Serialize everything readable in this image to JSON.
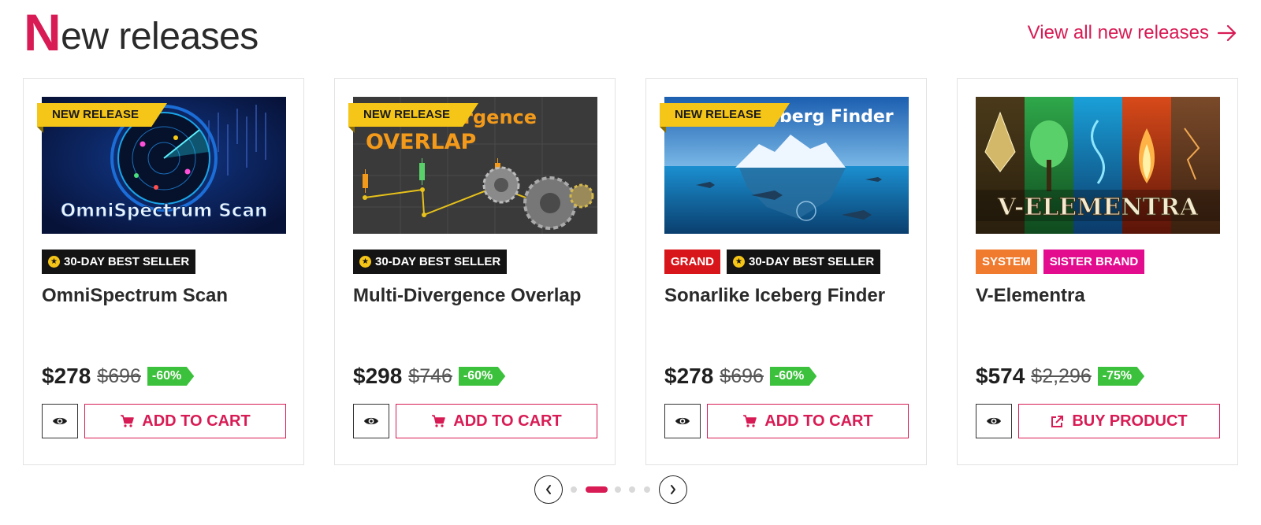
{
  "header": {
    "title_first": "N",
    "title_rest": "ew releases",
    "view_all": "View all new releases"
  },
  "colors": {
    "accent": "#d81b54",
    "ribbon": "#f5c518",
    "discount": "#3cc13c",
    "grand": "#d8151a",
    "system": "#f07a2d",
    "sister": "#e30c8f"
  },
  "products": [
    {
      "ribbon": "NEW RELEASE",
      "image_title": "OmniSpectrum Scan",
      "badges": [
        "30-DAY BEST SELLER"
      ],
      "name": "OmniSpectrum Scan",
      "price": "$278",
      "old_price": "$696",
      "discount": "-60%",
      "button": "ADD TO CART",
      "button_icon": "cart-icon"
    },
    {
      "ribbon": "NEW RELEASE",
      "image_title": "Multi-Divergence Overlap",
      "badges": [
        "30-DAY BEST SELLER"
      ],
      "name": "Multi-Divergence Overlap",
      "price": "$298",
      "old_price": "$746",
      "discount": "-60%",
      "button": "ADD TO CART",
      "button_icon": "cart-icon"
    },
    {
      "ribbon": "NEW RELEASE",
      "image_title": "Iceberg Finder",
      "badges": [
        "GRAND",
        "30-DAY BEST SELLER"
      ],
      "name": "Sonarlike Iceberg Finder",
      "price": "$278",
      "old_price": "$696",
      "discount": "-60%",
      "button": "ADD TO CART",
      "button_icon": "cart-icon"
    },
    {
      "ribbon": "",
      "image_title": "V-ELEMENTRA",
      "badges": [
        "SYSTEM",
        "SISTER BRAND"
      ],
      "name": "V-Elementra",
      "price": "$574",
      "old_price": "$2,296",
      "discount": "-75%",
      "button": "BUY PRODUCT",
      "button_icon": "external-link-icon"
    }
  ],
  "pager": {
    "page_count": 5,
    "active_index": 1
  }
}
